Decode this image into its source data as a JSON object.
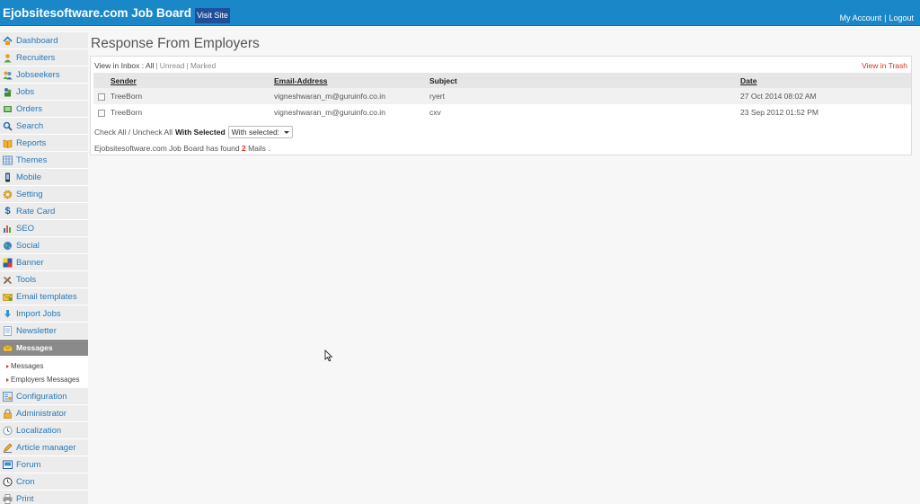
{
  "header": {
    "brand": "Ejobsitesoftware.com Job Board",
    "visit_site": "Visit Site",
    "my_account": "My Account",
    "separator": "|",
    "logout": "Logout"
  },
  "sidebar": {
    "items": [
      {
        "label": "Dashboard",
        "icon": "home-icon"
      },
      {
        "label": "Recruiters",
        "icon": "user-icon"
      },
      {
        "label": "Jobseekers",
        "icon": "users-icon"
      },
      {
        "label": "Jobs",
        "icon": "people-icon"
      },
      {
        "label": "Orders",
        "icon": "cart-icon"
      },
      {
        "label": "Search",
        "icon": "search-icon"
      },
      {
        "label": "Reports",
        "icon": "book-icon"
      },
      {
        "label": "Themes",
        "icon": "grid-icon"
      },
      {
        "label": "Mobile",
        "icon": "mobile-icon"
      },
      {
        "label": "Setting",
        "icon": "gear-icon"
      },
      {
        "label": "Rate Card",
        "icon": "dollar-icon"
      },
      {
        "label": "SEO",
        "icon": "bar-chart-icon"
      },
      {
        "label": "Social",
        "icon": "globe-icon"
      },
      {
        "label": "Banner",
        "icon": "banner-icon"
      },
      {
        "label": "Tools",
        "icon": "tools-icon"
      },
      {
        "label": "Email templates",
        "icon": "email-icon"
      },
      {
        "label": "Import Jobs",
        "icon": "download-icon"
      },
      {
        "label": "Newsletter",
        "icon": "newsletter-icon"
      },
      {
        "label": "Messages",
        "icon": "messages-icon",
        "active": true
      },
      {
        "label": "Configuration",
        "icon": "config-icon"
      },
      {
        "label": "Administrator",
        "icon": "lock-icon"
      },
      {
        "label": "Localization",
        "icon": "clock-icon"
      },
      {
        "label": "Article manager",
        "icon": "pencil-icon"
      },
      {
        "label": "Forum",
        "icon": "forum-icon"
      },
      {
        "label": "Cron",
        "icon": "cron-clock-icon"
      },
      {
        "label": "Print",
        "icon": "print-icon"
      }
    ],
    "sub_items": [
      "Messages",
      "Employers Messages"
    ]
  },
  "main": {
    "title": "Response From Employers",
    "filters": {
      "prefix": "View in Inbox :",
      "all": "All",
      "unread": "Unread",
      "marked": "Marked",
      "separator": "|"
    },
    "trash_link": "View in Trash",
    "table": {
      "headers": [
        "Sender",
        "Email-Address",
        "Subject",
        "Date"
      ],
      "rows": [
        {
          "sender": "TreeBorn",
          "email": "vigneshwaran_m@guruinfo.co.in",
          "subject": "ryert",
          "date": "27 Oct 2014 08:02 AM"
        },
        {
          "sender": "TreeBorn",
          "email": "vigneshwaran_m@guruinfo.co.in",
          "subject": "cxv",
          "date": "23 Sep 2012 01:52 PM"
        }
      ]
    },
    "actions": {
      "check_all": "Check All",
      "slash": "/",
      "uncheck_all": "Uncheck All",
      "with_selected_label": "With Selected",
      "select_value": "With selected:"
    },
    "found": {
      "prefix": "Ejobsitesoftware.com Job Board has found",
      "count": "2",
      "suffix": "Mails ."
    }
  },
  "colors": {
    "header_bg": "#1a87c8",
    "visit_btn_bg": "#1f4f9a",
    "link_blue": "#2878b8",
    "accent_red": "#d0341b",
    "active_nav_bg": "#8a8a8a"
  }
}
